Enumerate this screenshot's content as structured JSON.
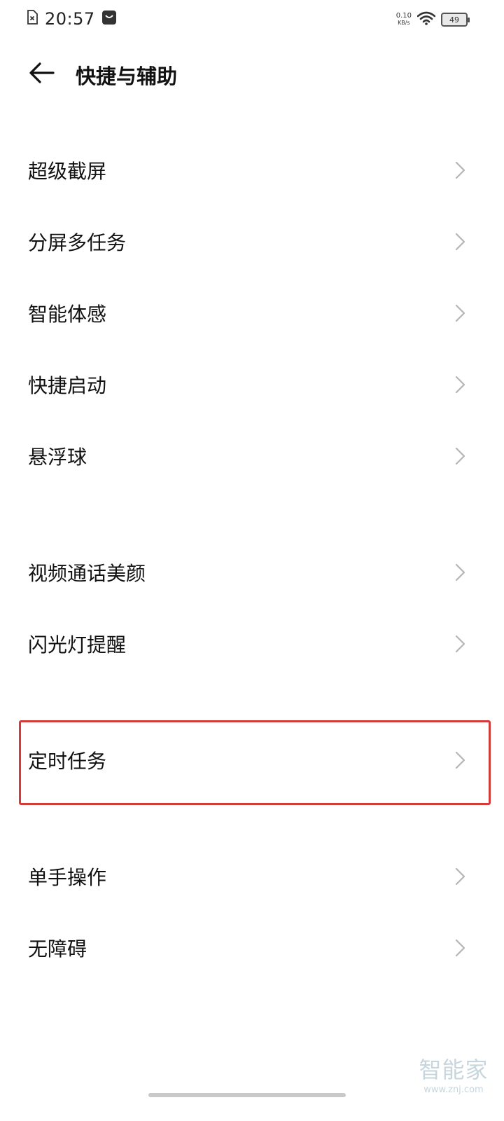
{
  "status_bar": {
    "time": "20:57",
    "net_speed_value": "0.10",
    "net_speed_unit": "KB/s",
    "battery_level": "49",
    "icons": [
      "sim-error-icon",
      "message-notification-icon",
      "wifi-icon",
      "battery-icon"
    ]
  },
  "header": {
    "title": "快捷与辅助"
  },
  "sections": [
    {
      "items": [
        {
          "label": "超级截屏"
        },
        {
          "label": "分屏多任务"
        },
        {
          "label": "智能体感"
        },
        {
          "label": "快捷启动"
        },
        {
          "label": "悬浮球"
        }
      ]
    },
    {
      "items": [
        {
          "label": "视频通话美颜"
        },
        {
          "label": "闪光灯提醒"
        }
      ]
    },
    {
      "items": [
        {
          "label": "定时任务",
          "highlighted": true
        }
      ]
    },
    {
      "items": [
        {
          "label": "单手操作"
        },
        {
          "label": "无障碍"
        }
      ]
    }
  ],
  "watermark": {
    "brand": "智能家",
    "url": "www.znj.com"
  },
  "colors": {
    "highlight_border": "#d33a3a",
    "chevron": "#b5b5b5",
    "watermark": "#c7d6dd"
  }
}
